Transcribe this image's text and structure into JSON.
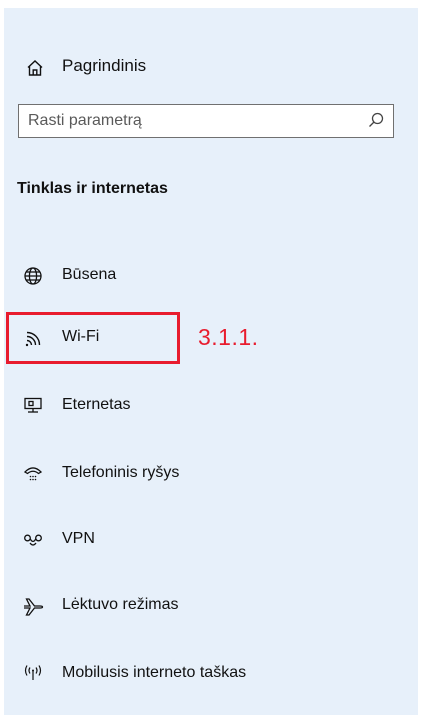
{
  "home": {
    "label": "Pagrindinis",
    "icon": "home-icon"
  },
  "search": {
    "placeholder": "Rasti parametrą",
    "icon": "search-icon"
  },
  "section": {
    "title": "Tinklas ir internetas"
  },
  "nav": {
    "items": [
      {
        "label": "Būsena",
        "icon": "globe-icon"
      },
      {
        "label": "Wi-Fi",
        "icon": "wifi-icon"
      },
      {
        "label": "Eternetas",
        "icon": "ethernet-icon"
      },
      {
        "label": "Telefoninis ryšys",
        "icon": "dial-up-icon"
      },
      {
        "label": "VPN",
        "icon": "vpn-icon"
      },
      {
        "label": "Lėktuvo režimas",
        "icon": "airplane-icon"
      },
      {
        "label": "Mobilusis interneto taškas",
        "icon": "hotspot-icon"
      }
    ]
  },
  "annotation": {
    "text": "3.1.1.",
    "color": "#e81c2e"
  },
  "colors": {
    "panel_background": "#e7f0fa",
    "highlight": "#e81c2e"
  }
}
